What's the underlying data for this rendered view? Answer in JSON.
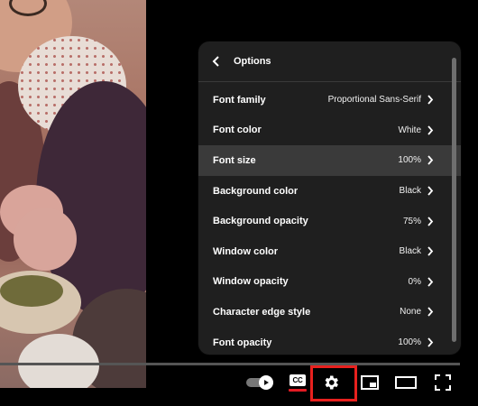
{
  "panel": {
    "title": "Options",
    "rows": [
      {
        "label": "Font family",
        "value": "Proportional Sans-Serif"
      },
      {
        "label": "Font color",
        "value": "White"
      },
      {
        "label": "Font size",
        "value": "100%"
      },
      {
        "label": "Background color",
        "value": "Black"
      },
      {
        "label": "Background opacity",
        "value": "75%"
      },
      {
        "label": "Window color",
        "value": "Black"
      },
      {
        "label": "Window opacity",
        "value": "0%"
      },
      {
        "label": "Character edge style",
        "value": "None"
      },
      {
        "label": "Font opacity",
        "value": "100%"
      }
    ],
    "highlighted_row": "Font size"
  },
  "controls": {
    "cc_label": "CC",
    "icons": [
      "autoplay-toggle-icon",
      "cc-icon",
      "gear-icon",
      "miniplayer-icon",
      "theater-mode-icon",
      "fullscreen-icon"
    ],
    "highlight_color": "#e8211e",
    "cc_underline_color": "#e31b23"
  },
  "colors": {
    "panel_bg": "#1f1f1f",
    "row_highlight": "#3a3a3a"
  }
}
